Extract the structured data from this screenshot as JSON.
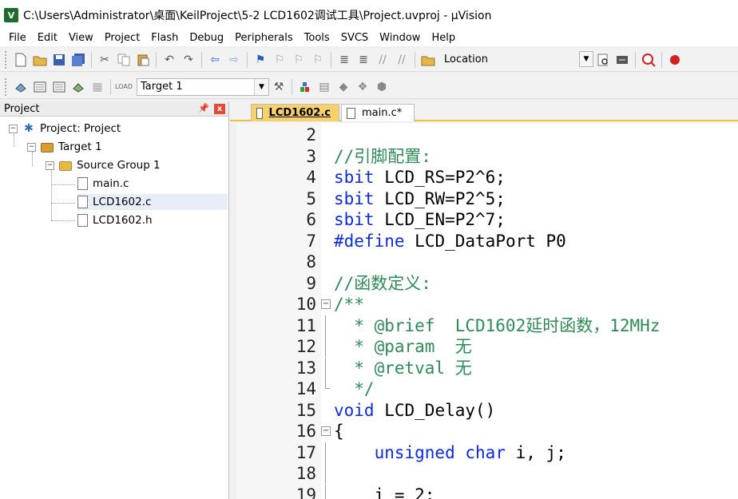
{
  "window": {
    "title": "C:\\Users\\Administrator\\桌面\\KeilProject\\5-2 LCD1602调试工具\\Project.uvproj - µVision"
  },
  "menu": [
    "File",
    "Edit",
    "View",
    "Project",
    "Flash",
    "Debug",
    "Peripherals",
    "Tools",
    "SVCS",
    "Window",
    "Help"
  ],
  "toolbar": {
    "location_label": "Location",
    "target_label": "Target 1"
  },
  "project_panel": {
    "title": "Project",
    "pin_symbol": "ꟷ",
    "close_symbol": "x",
    "tree": {
      "project": "Project: Project",
      "target": "Target 1",
      "group": "Source Group 1",
      "files": [
        "main.c",
        "LCD1602.c",
        "LCD1602.h"
      ]
    }
  },
  "tabs": [
    {
      "label": "LCD1602.c",
      "active": true
    },
    {
      "label": "main.c*",
      "active": false
    }
  ],
  "editor": {
    "lines": [
      {
        "n": "2",
        "t": ""
      },
      {
        "n": "3",
        "t": "//引脚配置:"
      },
      {
        "n": "4",
        "t": "sbit LCD_RS=P2^6;"
      },
      {
        "n": "5",
        "t": "sbit LCD_RW=P2^5;"
      },
      {
        "n": "6",
        "t": "sbit LCD_EN=P2^7;"
      },
      {
        "n": "7",
        "t": "#define LCD_DataPort P0"
      },
      {
        "n": "8",
        "t": ""
      },
      {
        "n": "9",
        "t": "//函数定义:"
      },
      {
        "n": "10",
        "t": "/**"
      },
      {
        "n": "11",
        "t": "  * @brief  LCD1602延时函数，12MHz"
      },
      {
        "n": "12",
        "t": "  * @param  无"
      },
      {
        "n": "13",
        "t": "  * @retval 无"
      },
      {
        "n": "14",
        "t": "  */"
      },
      {
        "n": "15",
        "t": "void LCD_Delay()"
      },
      {
        "n": "16",
        "t": "{"
      },
      {
        "n": "17",
        "t": "    unsigned char i, j;"
      },
      {
        "n": "18",
        "t": ""
      },
      {
        "n": "19",
        "t": "    i = 2;"
      }
    ]
  },
  "colors": {
    "comment": "#2e8b57",
    "keyword": "#0b2bdd",
    "active_tab": "#f7d26a"
  }
}
